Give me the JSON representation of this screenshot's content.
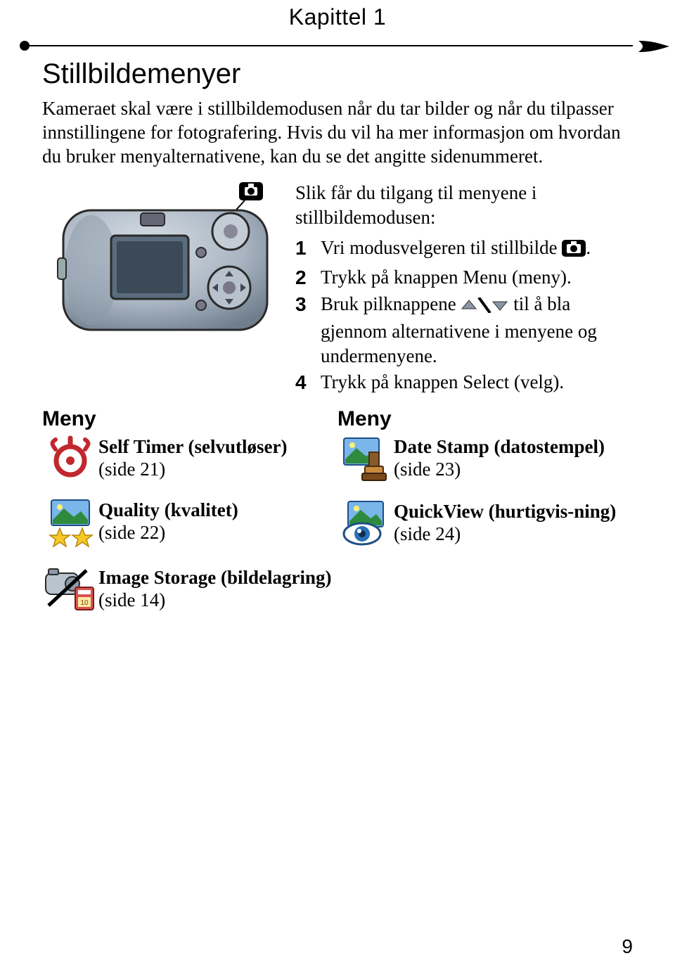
{
  "chapter": "Kapittel 1",
  "title": "Stillbildemenyer",
  "intro1": "Kameraet skal være i stillbildemodusen når du tar bilder og når du tilpasser innstillingene for fotografering. Hvis du vil ha mer informasjon om hvordan du bruker menyalternativene, kan du se det angitte sidenummeret.",
  "steps_intro": "Slik får du tilgang til menyene i stillbildemodusen:",
  "steps": {
    "n1": "1",
    "t1a": "Vri modusvelgeren til stillbilde ",
    "t1b": ".",
    "n2": "2",
    "t2": "Trykk på knappen Menu (meny).",
    "n3": "3",
    "t3a": "Bruk pilknappene ",
    "t3b": " til å bla gjennom alternativene i menyene og undermenyene.",
    "n4": "4",
    "t4": "Trykk på knappen Select (velg)."
  },
  "menu_label": "Meny",
  "left": {
    "i1_title": "Self Timer (selvutløser)",
    "i1_page": "(side 21)",
    "i2_title": "Quality (kvalitet)",
    "i2_page": "(side 22)",
    "i3_title": "Image Storage (bildelagring)",
    "i3_page": "(side 14)"
  },
  "right": {
    "i1_title": "Date Stamp (datostempel)",
    "i1_page": "(side 23)",
    "i2_title": "QuickView (hurtigvis-ning)",
    "i2_page": "(side 24)"
  },
  "page_number": "9"
}
